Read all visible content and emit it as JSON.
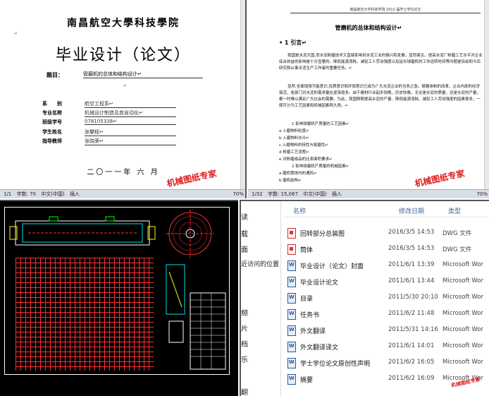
{
  "cover": {
    "school": "南昌航空大學科技學院",
    "title": "毕业设计（论文）",
    "topic_label": "题目：",
    "topic_value": "管磨机的总体和结构设计↵",
    "fields": [
      {
        "label": "系　　别",
        "value": "航空工程系↵"
      },
      {
        "label": "专业名称",
        "value": "机械设计制造及其自动化↵"
      },
      {
        "label": "班级学号",
        "value": "078105338↵"
      },
      {
        "label": "学生姓名",
        "value": "张攀程↵"
      },
      {
        "label": "指导教师",
        "value": "张晓荣↵"
      }
    ],
    "date": "二〇一一年 六 月",
    "status": {
      "page": "1/1",
      "words": "字数: 70",
      "lang": "中文(中国)",
      "mode": "插入",
      "zoom": "70%"
    },
    "watermark": "机械图纸专家"
  },
  "thesis": {
    "header": "南昌航空大学科技学院 2011 届学士学位论文",
    "title": "管磨机的总体和结构设计↵",
    "section": "• 1 引言↵",
    "paragraphs": [
      "我国是水泥大国,而水泥粉磨技术又直接影响到水泥工业的振兴和发展，显而易见，提高水泥厂粉磨工艺水平对企业综合效益的影响是十分显著的。降低能源消耗，减轻工人劳动强度以及延长球磨机的工作运转时间等问题是目前和今后研究和从事水泥生产工作者的重要任务。↵",
      "显然,全面增强节能意识,优质意识和环保意识已成为广大水泥企业的当务之急。随着体制的改革，企业内部的经济搞活，各部门对水泥的需求量在逐渐增多。由于建材行业起步较晚，历史较晚，无论是水泥的质量，还是水泥的产量，都一时难以满足广大社会的需要。为此，我国刚刚提高水泥的产量、降低能源消耗、减轻工人劳动强度的因素很多，一般可分为工艺因素和机械因素两大类。↵"
    ],
    "items": [
      "1 影响球磨机产质量的工艺因素↵",
      "a 入磨物料粒度↵",
      "b 入磨物料水分↵",
      "c 入磨物料的特性与易磨性↵",
      "d 粉磨工艺流程↵",
      "e 对粉磨成品的比表面积要求↵",
      "2 影响球磨机产质量的机械因素↵",
      "a 磨机筒体内的通风↵",
      "b 磨机结构↵"
    ],
    "status": {
      "page": "1/32",
      "words": "字数: 15,067",
      "lang": "中文(中国)",
      "mode": "插入",
      "zoom": "70%"
    },
    "watermark": "机械图纸专家"
  },
  "explorer": {
    "nav": [
      "读",
      "载",
      "面",
      "近访问的位置",
      "频",
      "片",
      "档",
      "乐",
      "翻"
    ],
    "columns": {
      "name": "名称",
      "date": "修改日期",
      "type": "类型"
    },
    "files": [
      {
        "name": "回转部分总装图",
        "date": "2016/3/5 14:53",
        "type": "DWG 文件",
        "kind": "dwg"
      },
      {
        "name": "筒体",
        "date": "2016/3/5 14:53",
        "type": "DWG 文件",
        "kind": "dwg"
      },
      {
        "name": "毕业设计（论文）封面",
        "date": "2011/6/1 13:39",
        "type": "Microsoft Wor",
        "kind": "word"
      },
      {
        "name": "毕业设计论文",
        "date": "2011/6/1 13:44",
        "type": "Microsoft Wor",
        "kind": "word"
      },
      {
        "name": "目录",
        "date": "2011/5/30 20:10",
        "type": "Microsoft Wor",
        "kind": "word"
      },
      {
        "name": "任务书",
        "date": "2011/6/2 11:48",
        "type": "Microsoft Wor",
        "kind": "word"
      },
      {
        "name": "外文翻译",
        "date": "2011/5/31 14:16",
        "type": "Microsoft Wor",
        "kind": "word"
      },
      {
        "name": "外文翻译译文",
        "date": "2011/6/1 14:01",
        "type": "Microsoft Wor",
        "kind": "word"
      },
      {
        "name": "学士学位论文原创性声明",
        "date": "2011/6/2 16:05",
        "type": "Microsoft Wor",
        "kind": "word"
      },
      {
        "name": "摘要",
        "date": "2011/6/2 16:09",
        "type": "Microsoft Wor",
        "kind": "word"
      }
    ],
    "watermark": "机械图纸专家"
  },
  "colors": {
    "accent": "#4a5fa0",
    "watermark": "#e01a1a",
    "cad_bg": "#000000",
    "cad_grid": "#ff3030"
  }
}
